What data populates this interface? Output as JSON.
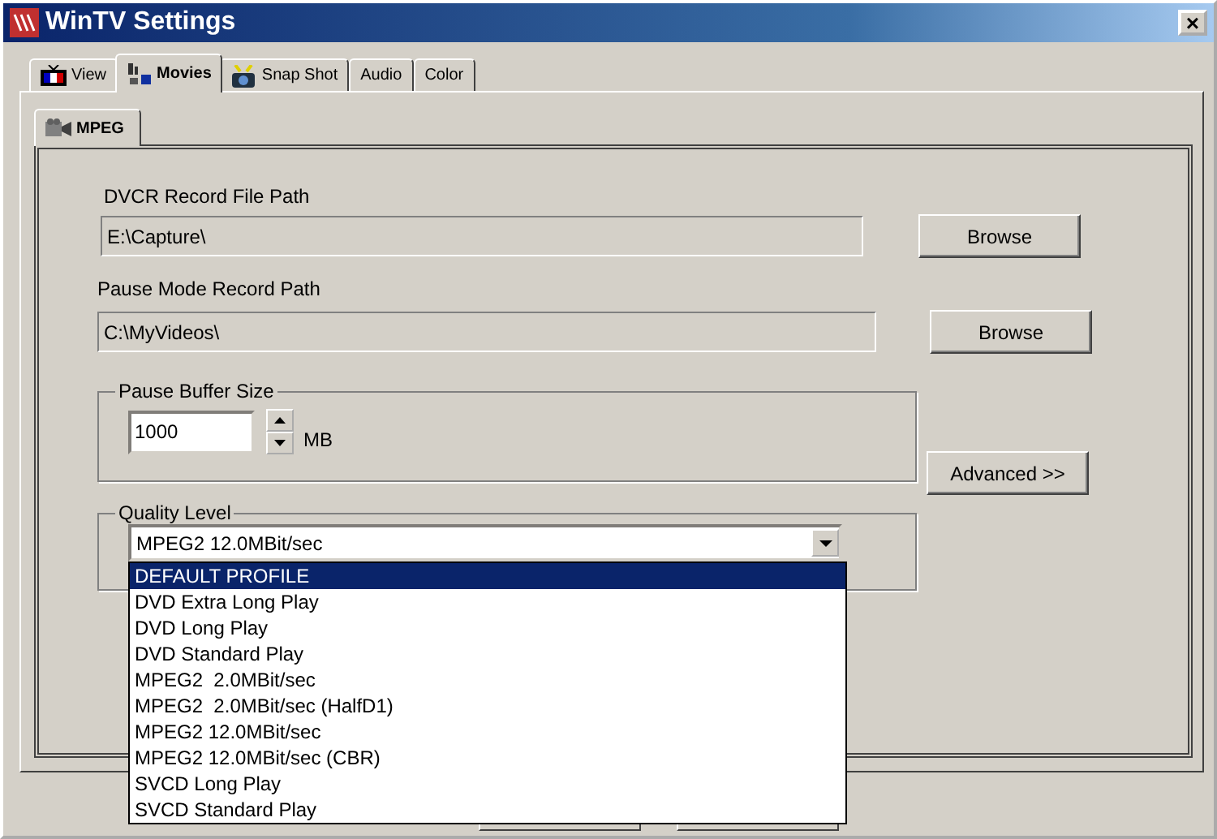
{
  "window": {
    "title": "WinTV Settings",
    "close": "×"
  },
  "tabs": [
    {
      "label": "View",
      "selected": false,
      "kind": "tv"
    },
    {
      "label": "Movies",
      "selected": true,
      "kind": "film"
    },
    {
      "label": "Snap Shot",
      "selected": false,
      "kind": "camera"
    },
    {
      "label": "Audio",
      "selected": false
    },
    {
      "label": "Color",
      "selected": false
    }
  ],
  "subtabs": [
    {
      "label": "MPEG",
      "selected": true
    }
  ],
  "dvcr_path": {
    "label": "DVCR Record File Path",
    "value": "E:\\Capture\\",
    "button": "Browse"
  },
  "pause_path": {
    "label": "Pause Mode Record Path",
    "value": "C:\\MyVideos\\",
    "button": "Browse"
  },
  "buffer": {
    "label": "Pause Buffer Size",
    "value": "1000",
    "unit": "MB"
  },
  "advanced_button": "Advanced >>",
  "quality": {
    "label": "Quality Level",
    "value": "MPEG2 12.0MBit/sec",
    "expanded": true,
    "options": [
      {
        "label": "DEFAULT PROFILE",
        "highlighted": true
      },
      {
        "label": "DVD Extra Long Play",
        "highlighted": false
      },
      {
        "label": "DVD Long Play",
        "highlighted": false
      },
      {
        "label": "DVD Standard Play",
        "highlighted": false
      },
      {
        "label": "MPEG2  2.0MBit/sec",
        "highlighted": false
      },
      {
        "label": "MPEG2  2.0MBit/sec (HalfD1)",
        "highlighted": false
      },
      {
        "label": "MPEG2 12.0MBit/sec",
        "highlighted": false
      },
      {
        "label": "MPEG2 12.0MBit/sec (CBR)",
        "highlighted": false
      },
      {
        "label": "SVCD Long Play",
        "highlighted": false
      },
      {
        "label": "SVCD Standard Play",
        "highlighted": false
      }
    ]
  }
}
